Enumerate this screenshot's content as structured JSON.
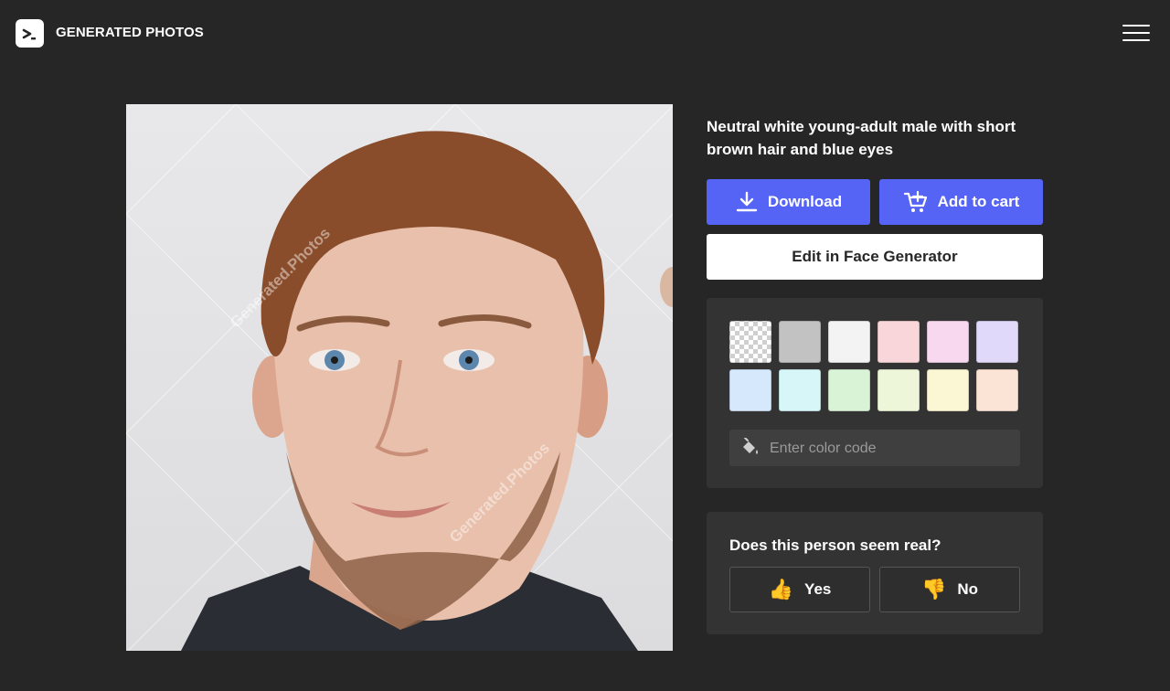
{
  "header": {
    "brand": "GENERATED PHOTOS"
  },
  "photo": {
    "watermark": "Generated.Photos"
  },
  "details": {
    "description": "Neutral white young-adult male with short brown hair and blue eyes",
    "download_label": "Download",
    "cart_label": "Add to cart",
    "edit_label": "Edit in Face Generator"
  },
  "background_colors": {
    "swatches": [
      {
        "name": "transparent",
        "color": "transparent"
      },
      {
        "name": "gray",
        "color": "#c2c2c2"
      },
      {
        "name": "white",
        "color": "#f3f3f3"
      },
      {
        "name": "rose",
        "color": "#f9d6d9"
      },
      {
        "name": "pink",
        "color": "#f8d8ee"
      },
      {
        "name": "lavender",
        "color": "#e0d9fa"
      },
      {
        "name": "light-blue",
        "color": "#d6e8fb"
      },
      {
        "name": "cyan",
        "color": "#d6f6f8"
      },
      {
        "name": "mint",
        "color": "#d9f3d6"
      },
      {
        "name": "lime",
        "color": "#eef6d9"
      },
      {
        "name": "cream",
        "color": "#fbf6d4"
      },
      {
        "name": "peach",
        "color": "#fbe3d5"
      }
    ],
    "color_code_placeholder": "Enter color code"
  },
  "feedback": {
    "question": "Does this person seem real?",
    "yes_label": "Yes",
    "no_label": "No"
  },
  "colors": {
    "accent": "#5664f5",
    "background": "#262626",
    "panel": "#333333"
  },
  "icons": [
    "logo-icon",
    "menu-icon",
    "download-icon",
    "cart-icon",
    "paint-bucket-icon",
    "thumbs-up-icon",
    "thumbs-down-icon"
  ]
}
